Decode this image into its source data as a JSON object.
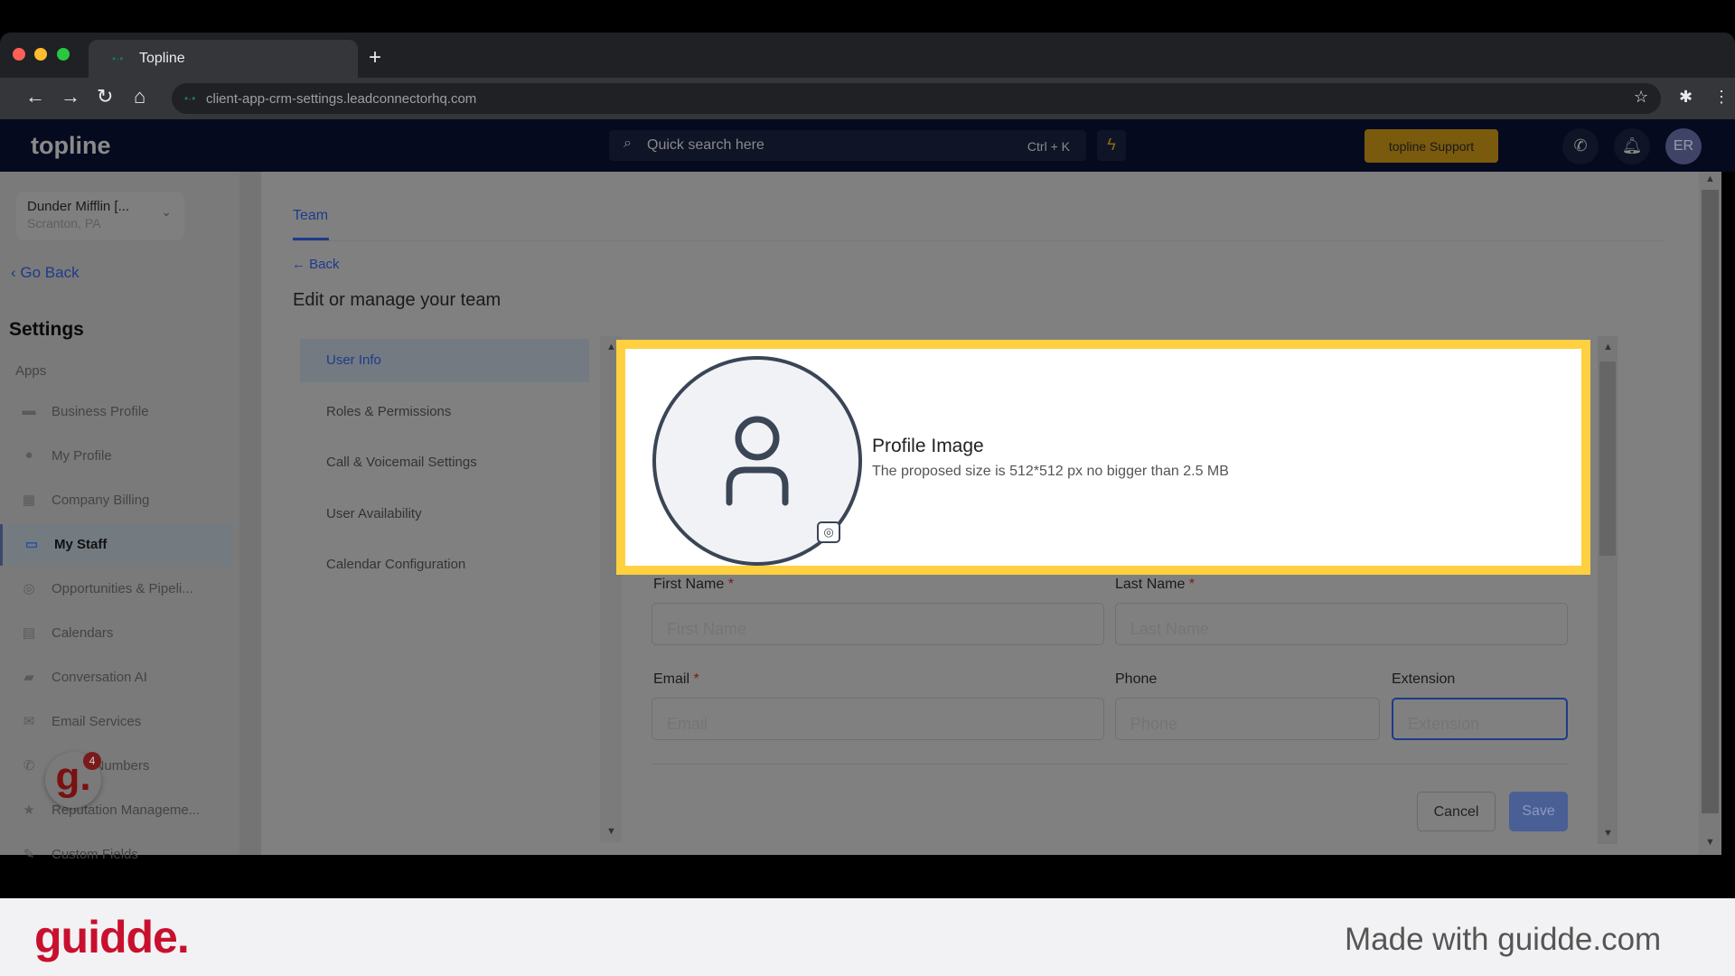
{
  "browser": {
    "tab_title": "Topline",
    "url": "client-app-crm-settings.leadconnectorhq.com"
  },
  "appbar": {
    "logo": "topline",
    "search_placeholder": "Quick search here",
    "search_shortcut": "Ctrl + K",
    "support_label": "topline Support",
    "avatar_initials": "ER"
  },
  "sidebar": {
    "location_name": "Dunder Mifflin [...",
    "location_sub": "Scranton, PA",
    "go_back": "Go Back",
    "settings_title": "Settings",
    "section": "Apps",
    "items": [
      {
        "label": "Business Profile",
        "icon": "briefcase-icon"
      },
      {
        "label": "My Profile",
        "icon": "person-icon"
      },
      {
        "label": "Company Billing",
        "icon": "grid-icon"
      },
      {
        "label": "My Staff",
        "icon": "inbox-icon",
        "active": true
      },
      {
        "label": "Opportunities & Pipeli...",
        "icon": "target-icon"
      },
      {
        "label": "Calendars",
        "icon": "calendar-icon"
      },
      {
        "label": "Conversation AI",
        "icon": "chat-icon"
      },
      {
        "label": "Email Services",
        "icon": "mail-icon"
      },
      {
        "label": "Phone Numbers",
        "icon": "phone-icon"
      },
      {
        "label": "Reputation Manageme...",
        "icon": "star-icon"
      },
      {
        "label": "Custom Fields",
        "icon": "fields-icon"
      }
    ],
    "guidde_badge_count": "4"
  },
  "main": {
    "tab": "Team",
    "back": "Back",
    "heading": "Edit or manage your team",
    "menu": [
      {
        "label": "User Info",
        "active": true
      },
      {
        "label": "Roles & Permissions"
      },
      {
        "label": "Call & Voicemail Settings"
      },
      {
        "label": "User Availability"
      },
      {
        "label": "Calendar Configuration"
      }
    ]
  },
  "form": {
    "profile_title": "Profile Image",
    "profile_sub": "The proposed size is 512*512 px no bigger than 2.5 MB",
    "first_name": {
      "label": "First Name",
      "placeholder": "First Name",
      "value": ""
    },
    "last_name": {
      "label": "Last Name",
      "placeholder": "Last Name",
      "value": ""
    },
    "email": {
      "label": "Email",
      "placeholder": "Email",
      "value": ""
    },
    "phone": {
      "label": "Phone",
      "placeholder": "Phone",
      "value": ""
    },
    "extension": {
      "label": "Extension",
      "placeholder": "Extension",
      "value": ""
    },
    "required_mark": "*",
    "cancel": "Cancel",
    "save": "Save"
  },
  "footer": {
    "logo": "guidde.",
    "made_with": "Made with guidde.com"
  },
  "colors": {
    "highlight": "#ffd040",
    "accent": "#1e3b8a",
    "brand_red": "#c8102e"
  }
}
